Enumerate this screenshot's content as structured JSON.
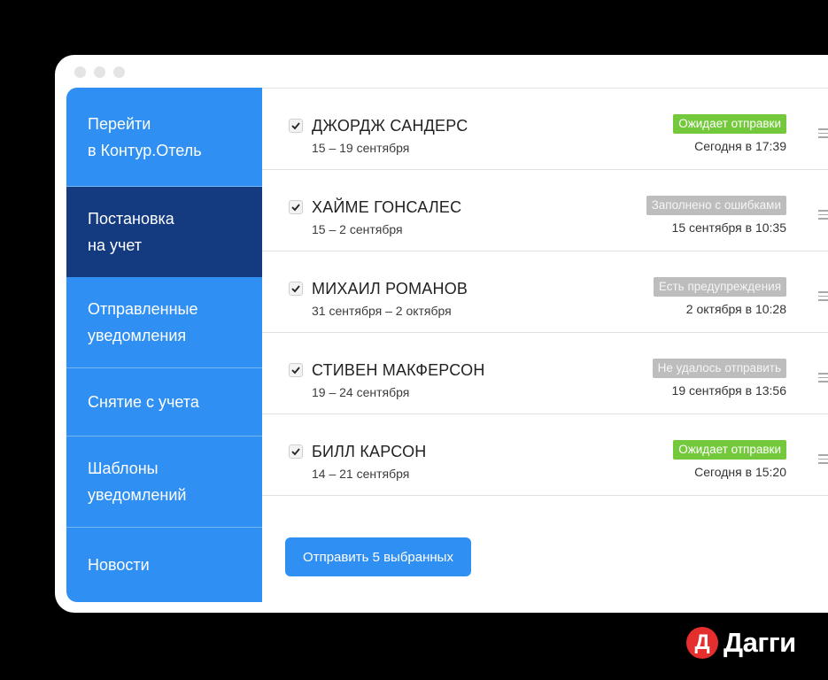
{
  "sidebar": {
    "items": [
      {
        "line1": "Перейти",
        "line2": "в Контур.Отель",
        "active": false
      },
      {
        "line1": "Постановка",
        "line2": "на учет",
        "active": true
      },
      {
        "line1": "Отправленные",
        "line2": "уведомления",
        "active": false
      },
      {
        "line1": "Снятие с учета",
        "line2": "",
        "active": false
      },
      {
        "line1": "Шаблоны",
        "line2": "уведомлений",
        "active": false
      },
      {
        "line1": "Новости",
        "line2": "",
        "active": false
      }
    ]
  },
  "guests": [
    {
      "name": "ДЖОРДЖ САНДЕРС",
      "dates": "15 – 19 сентября",
      "status": "Ожидает отправки",
      "status_type": "green",
      "time": "Сегодня в 17:39",
      "checked": true
    },
    {
      "name": "ХАЙМЕ ГОНСАЛЕС",
      "dates": "15 – 2 сентября",
      "status": "Заполнено с ошибками",
      "status_type": "gray",
      "time": "15 сентября в 10:35",
      "checked": true
    },
    {
      "name": "МИХАИЛ РОМАНОВ",
      "dates": "31 сентября – 2 октября",
      "status": "Есть предупреждения",
      "status_type": "gray",
      "time": "2 октября в 10:28",
      "checked": true
    },
    {
      "name": "СТИВЕН МАКФЕРСОН",
      "dates": "19 – 24 сентября",
      "status": "Не удалось отправить",
      "status_type": "gray",
      "time": "19 сентября в 13:56",
      "checked": true
    },
    {
      "name": "БИЛЛ КАРСОН",
      "dates": "14 – 21 сентября",
      "status": "Ожидает отправки",
      "status_type": "green",
      "time": "Сегодня в 15:20",
      "checked": true
    }
  ],
  "send_button": "Отправить 5 выбранных",
  "logo": {
    "mark": "Д",
    "text": "Дагги"
  },
  "colors": {
    "sidebar": "#2f8ff2",
    "sidebar_active": "#143a80",
    "status_green": "#74c83b",
    "status_gray": "#bdbdbd",
    "logo_red": "#e52e2e"
  }
}
